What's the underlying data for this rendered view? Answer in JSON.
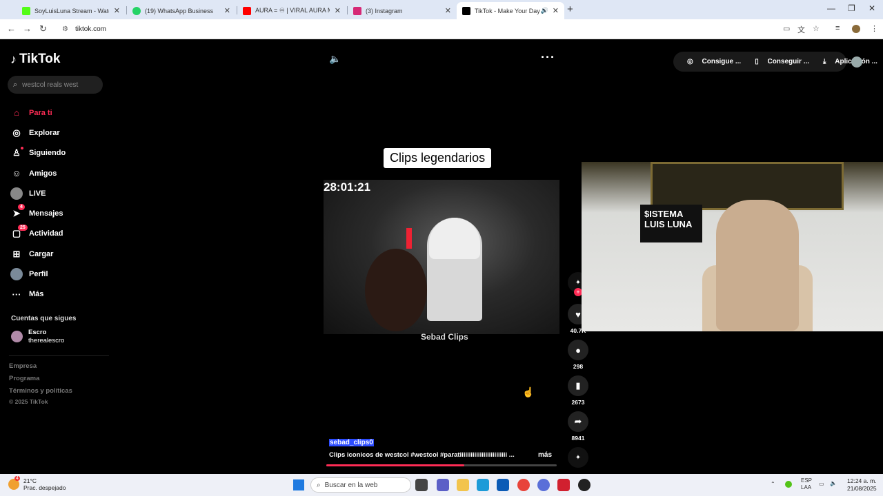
{
  "browser": {
    "tabs": [
      {
        "title": "SoyLuisLuna Stream - Watch Li",
        "favicon_color": "#53fc18",
        "active": false
      },
      {
        "title": "(19) WhatsApp Business",
        "favicon_color": "#25d366",
        "active": false
      },
      {
        "title": "AURA = ♾ | VIRAL AURA MUS",
        "favicon_color": "#ff0000",
        "active": false
      },
      {
        "title": "(3) Instagram",
        "favicon_color": "#d62976",
        "active": false
      },
      {
        "title": "TikTok - Make Your Day",
        "favicon_color": "#000000",
        "active": true
      }
    ],
    "url": "tiktok.com"
  },
  "sidebar": {
    "logo": "TikTok",
    "search_placeholder": "westcol reals west",
    "nav": [
      {
        "label": "Para ti",
        "icon": "home-icon"
      },
      {
        "label": "Explorar",
        "icon": "compass-icon"
      },
      {
        "label": "Siguiendo",
        "icon": "following-icon"
      },
      {
        "label": "Amigos",
        "icon": "friends-icon"
      },
      {
        "label": "LIVE",
        "icon": "live-icon"
      },
      {
        "label": "Mensajes",
        "icon": "message-icon",
        "badge": "4"
      },
      {
        "label": "Actividad",
        "icon": "activity-icon",
        "badge": "25"
      },
      {
        "label": "Cargar",
        "icon": "upload-icon"
      },
      {
        "label": "Perfil",
        "icon": "profile-icon"
      },
      {
        "label": "Más",
        "icon": "more-icon"
      }
    ],
    "following_title": "Cuentas que sigues",
    "following": [
      {
        "name": "Escro",
        "handle": "therealescro"
      }
    ],
    "footer": [
      "Empresa",
      "Programa",
      "Términos y políticas"
    ],
    "copyright": "© 2025 TikTok"
  },
  "top_actions": {
    "items": [
      "Consigue ...",
      "Conseguir ...",
      "Aplicación ..."
    ]
  },
  "video": {
    "title_banner": "Clips legendarios",
    "timer": "28:01:21",
    "watermark": "Sebad Clips",
    "author": "sebad_clips0",
    "caption": "Clips iconicos de westcol #westcol  #paratiiiiiiiiiiiiiiiiiiiiiiiiii  ...",
    "more": "más",
    "progress_fraction": 0.6
  },
  "actions": {
    "likes": "40.7K",
    "comments": "298",
    "saves": "2673",
    "shares": "8941"
  },
  "webcam": {
    "sign_text": "$ISTEMA LUIS LUNA"
  },
  "taskbar": {
    "weather_temp": "21°C",
    "weather_desc": "Prac. despejado",
    "weather_badge": "4",
    "search_placeholder": "Buscar en la web",
    "lang": "ESP",
    "lang_sub": "LAA",
    "time": "12:24 a. m.",
    "date": "21/08/2025"
  }
}
